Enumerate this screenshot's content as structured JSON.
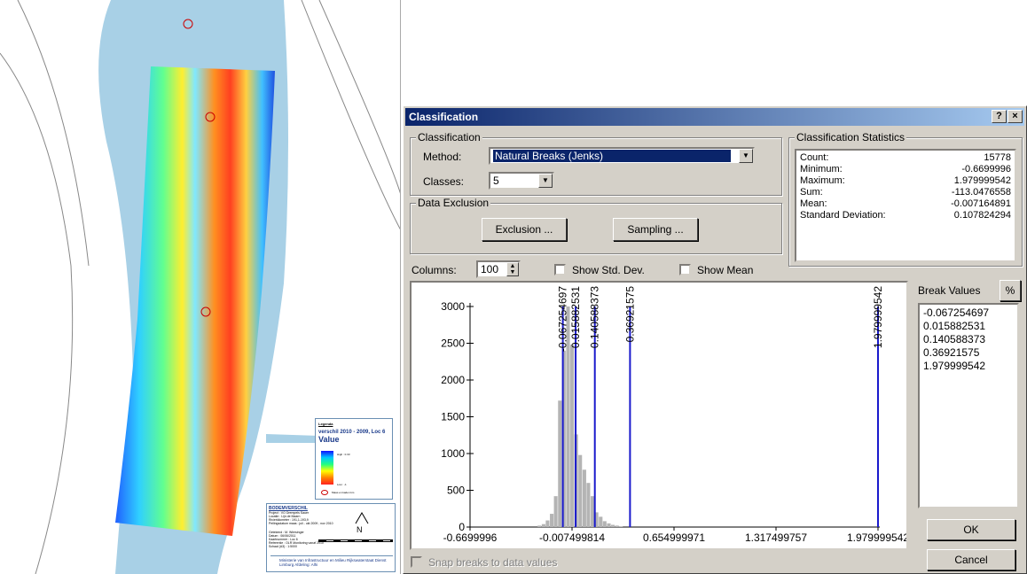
{
  "map": {
    "legend": {
      "heading": "Legenda",
      "title": "verschil 2010 - 2009, Loc 6",
      "value_label": "Value",
      "high": "High : 0.33",
      "low": "Low : -1",
      "marker": "Maas en kaden km"
    },
    "titleblock": {
      "title": "BODEMVERSCHIL",
      "lines": [
        "Project : VO Drempels Sauer",
        "Locatie : Lijn de Maarn",
        "Rivierkilometer : 191,1-193,9",
        "Peilingsdatum maas : juli - okt 2009 ; nov 2010"
      ],
      "details": [
        "Getekend : M. Wiersinger",
        "Datum : 06/06/2011",
        "Kaartnummer : Loc 6",
        "Referentie : OLR Monitoring vanaf 2010",
        "Schaal (A3) : 1:5000"
      ],
      "north": "N",
      "ministry": "Ministerie van Infrastructuur en Milieu  Rijkswaterstaat Dienst Limburg  Afdeling: Alhi"
    }
  },
  "dialog": {
    "title": "Classification",
    "help_btn": "?",
    "close_btn": "×",
    "classification_group": "Classification",
    "method_label": "Method:",
    "method_value": "Natural Breaks (Jenks)",
    "classes_label": "Classes:",
    "classes_value": "5",
    "exclusion_group": "Data Exclusion",
    "exclusion_btn": "Exclusion ...",
    "sampling_btn": "Sampling ...",
    "stats_group": "Classification Statistics",
    "stats": [
      {
        "label": "Count:",
        "value": "15778"
      },
      {
        "label": "Minimum:",
        "value": "-0.6699996"
      },
      {
        "label": "Maximum:",
        "value": "1.979999542"
      },
      {
        "label": "Sum:",
        "value": "-113.0476558"
      },
      {
        "label": "Mean:",
        "value": "-0.007164891"
      },
      {
        "label": "Standard Deviation:",
        "value": "0.107824294"
      }
    ],
    "columns_label": "Columns:",
    "columns_value": "100",
    "show_std_dev": "Show Std. Dev.",
    "show_mean": "Show Mean",
    "break_values_label": "Break Values",
    "percent_btn": "%",
    "break_values": [
      "-0.067254697",
      "0.015882531",
      "0.140588373",
      "0.36921575",
      "1.979999542"
    ],
    "ok_btn": "OK",
    "cancel_btn": "Cancel",
    "snap_label": "Snap breaks to data values"
  },
  "chart_data": {
    "type": "bar",
    "xlim": [
      -0.6699996,
      1.979999542
    ],
    "ylim": [
      0,
      3000
    ],
    "y_ticks": [
      0,
      500,
      1000,
      1500,
      2000,
      2500,
      3000
    ],
    "x_tick_labels": [
      "-0.6699996",
      "-0.007499814",
      "0.654999971",
      "1.317499757",
      "1.979999542"
    ],
    "x_tick_values": [
      -0.6699996,
      -0.007499814,
      0.654999971,
      1.317499757,
      1.979999542
    ],
    "bin_width": 0.0265,
    "bins": [
      {
        "x": -0.218,
        "y": 20
      },
      {
        "x": -0.191,
        "y": 40
      },
      {
        "x": -0.165,
        "y": 90
      },
      {
        "x": -0.138,
        "y": 180
      },
      {
        "x": -0.112,
        "y": 420
      },
      {
        "x": -0.085,
        "y": 1720
      },
      {
        "x": -0.059,
        "y": 2400
      },
      {
        "x": -0.032,
        "y": 3000
      },
      {
        "x": -0.006,
        "y": 2480
      },
      {
        "x": 0.021,
        "y": 1260
      },
      {
        "x": 0.047,
        "y": 980
      },
      {
        "x": 0.074,
        "y": 780
      },
      {
        "x": 0.1,
        "y": 600
      },
      {
        "x": 0.127,
        "y": 420
      },
      {
        "x": 0.153,
        "y": 200
      },
      {
        "x": 0.18,
        "y": 140
      },
      {
        "x": 0.206,
        "y": 80
      },
      {
        "x": 0.233,
        "y": 50
      },
      {
        "x": 0.259,
        "y": 30
      },
      {
        "x": 0.286,
        "y": 20
      },
      {
        "x": 0.312,
        "y": 10
      }
    ],
    "breaks": [
      -0.067254697,
      0.015882531,
      0.140588373,
      0.36921575,
      1.979999542
    ],
    "break_labels": [
      "-0.067254697",
      "0.015882531",
      "0.140588373",
      "0.36921575",
      "1.979999542"
    ],
    "colors": {
      "bar": "#b4b4b4",
      "break": "#1a1acc"
    }
  }
}
